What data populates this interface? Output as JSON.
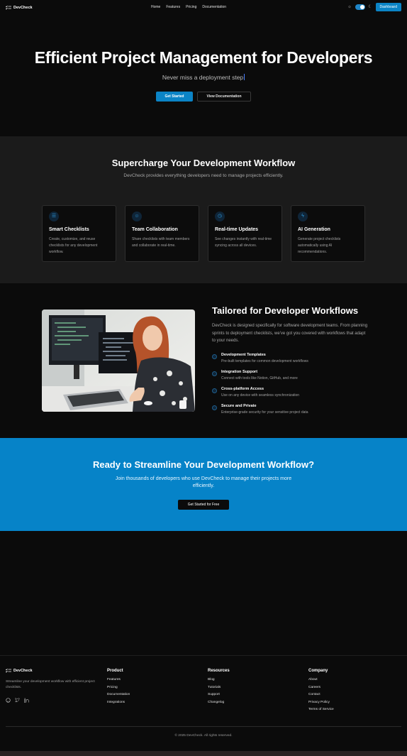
{
  "nav": {
    "brand": "DevCheck",
    "links": [
      "Home",
      "Features",
      "Pricing",
      "Documentation"
    ],
    "dashboard_label": "Dashboard",
    "theme_toggle_on": true
  },
  "hero": {
    "title": "Efficient Project Management for Developers",
    "subtitle": "Never miss a deployment step",
    "primary_cta": "Get Started",
    "secondary_cta": "View Documentation"
  },
  "features": {
    "title": "Supercharge Your Development Workflow",
    "subtitle": "DevCheck provides everything developers need to manage projects efficiently.",
    "cards": [
      {
        "icon": "checklist-icon",
        "title": "Smart Checklists",
        "text": "Create, customize, and reuse checklists for any development workflow."
      },
      {
        "icon": "users-icon",
        "title": "Team Collaboration",
        "text": "Share checklists with team members and collaborate in real-time."
      },
      {
        "icon": "clock-icon",
        "title": "Real-time Updates",
        "text": "See changes instantly with real-time syncing across all devices."
      },
      {
        "icon": "bolt-icon",
        "title": "AI Generation",
        "text": "Generate project checklists automatically using AI recommendations."
      }
    ]
  },
  "tailored": {
    "title": "Tailored for Developer Workflows",
    "text": "DevCheck is designed specifically for software development teams. From planning sprints to deployment checklists, we've got you covered with workflows that adapt to your needs.",
    "items": [
      {
        "title": "Development Templates",
        "desc": "Pre-built templates for common development workflows"
      },
      {
        "title": "Integration Support",
        "desc": "Connect with tools like Notion, GitHub, and more"
      },
      {
        "title": "Cross-platform Access",
        "desc": "Use on any device with seamless synchronization"
      },
      {
        "title": "Secure and Private",
        "desc": "Enterprise-grade security for your sensitive project data"
      }
    ]
  },
  "cta": {
    "title": "Ready to Streamline Your Development Workflow?",
    "subtitle": "Join thousands of developers who use DevCheck to manage their projects more efficiently.",
    "button": "Get Started for Free"
  },
  "footer": {
    "brand": "DevCheck",
    "description": "Streamline your development workflow with efficient project checklists.",
    "social": [
      "github-icon",
      "twitter-icon",
      "linkedin-icon"
    ],
    "columns": [
      {
        "title": "Product",
        "links": [
          "Features",
          "Pricing",
          "Documentation",
          "Integrations"
        ]
      },
      {
        "title": "Resources",
        "links": [
          "Blog",
          "Tutorials",
          "Support",
          "Changelog"
        ]
      },
      {
        "title": "Company",
        "links": [
          "About",
          "Careers",
          "Contact",
          "Privacy Policy",
          "Terms of Service"
        ]
      }
    ],
    "copyright": "© 2025 DevCheck. All rights reserved."
  },
  "colors": {
    "accent": "#0b84c6",
    "background": "#0b0b0b",
    "section_alt": "#1b1b1b",
    "cta_bg": "#0683c8"
  }
}
